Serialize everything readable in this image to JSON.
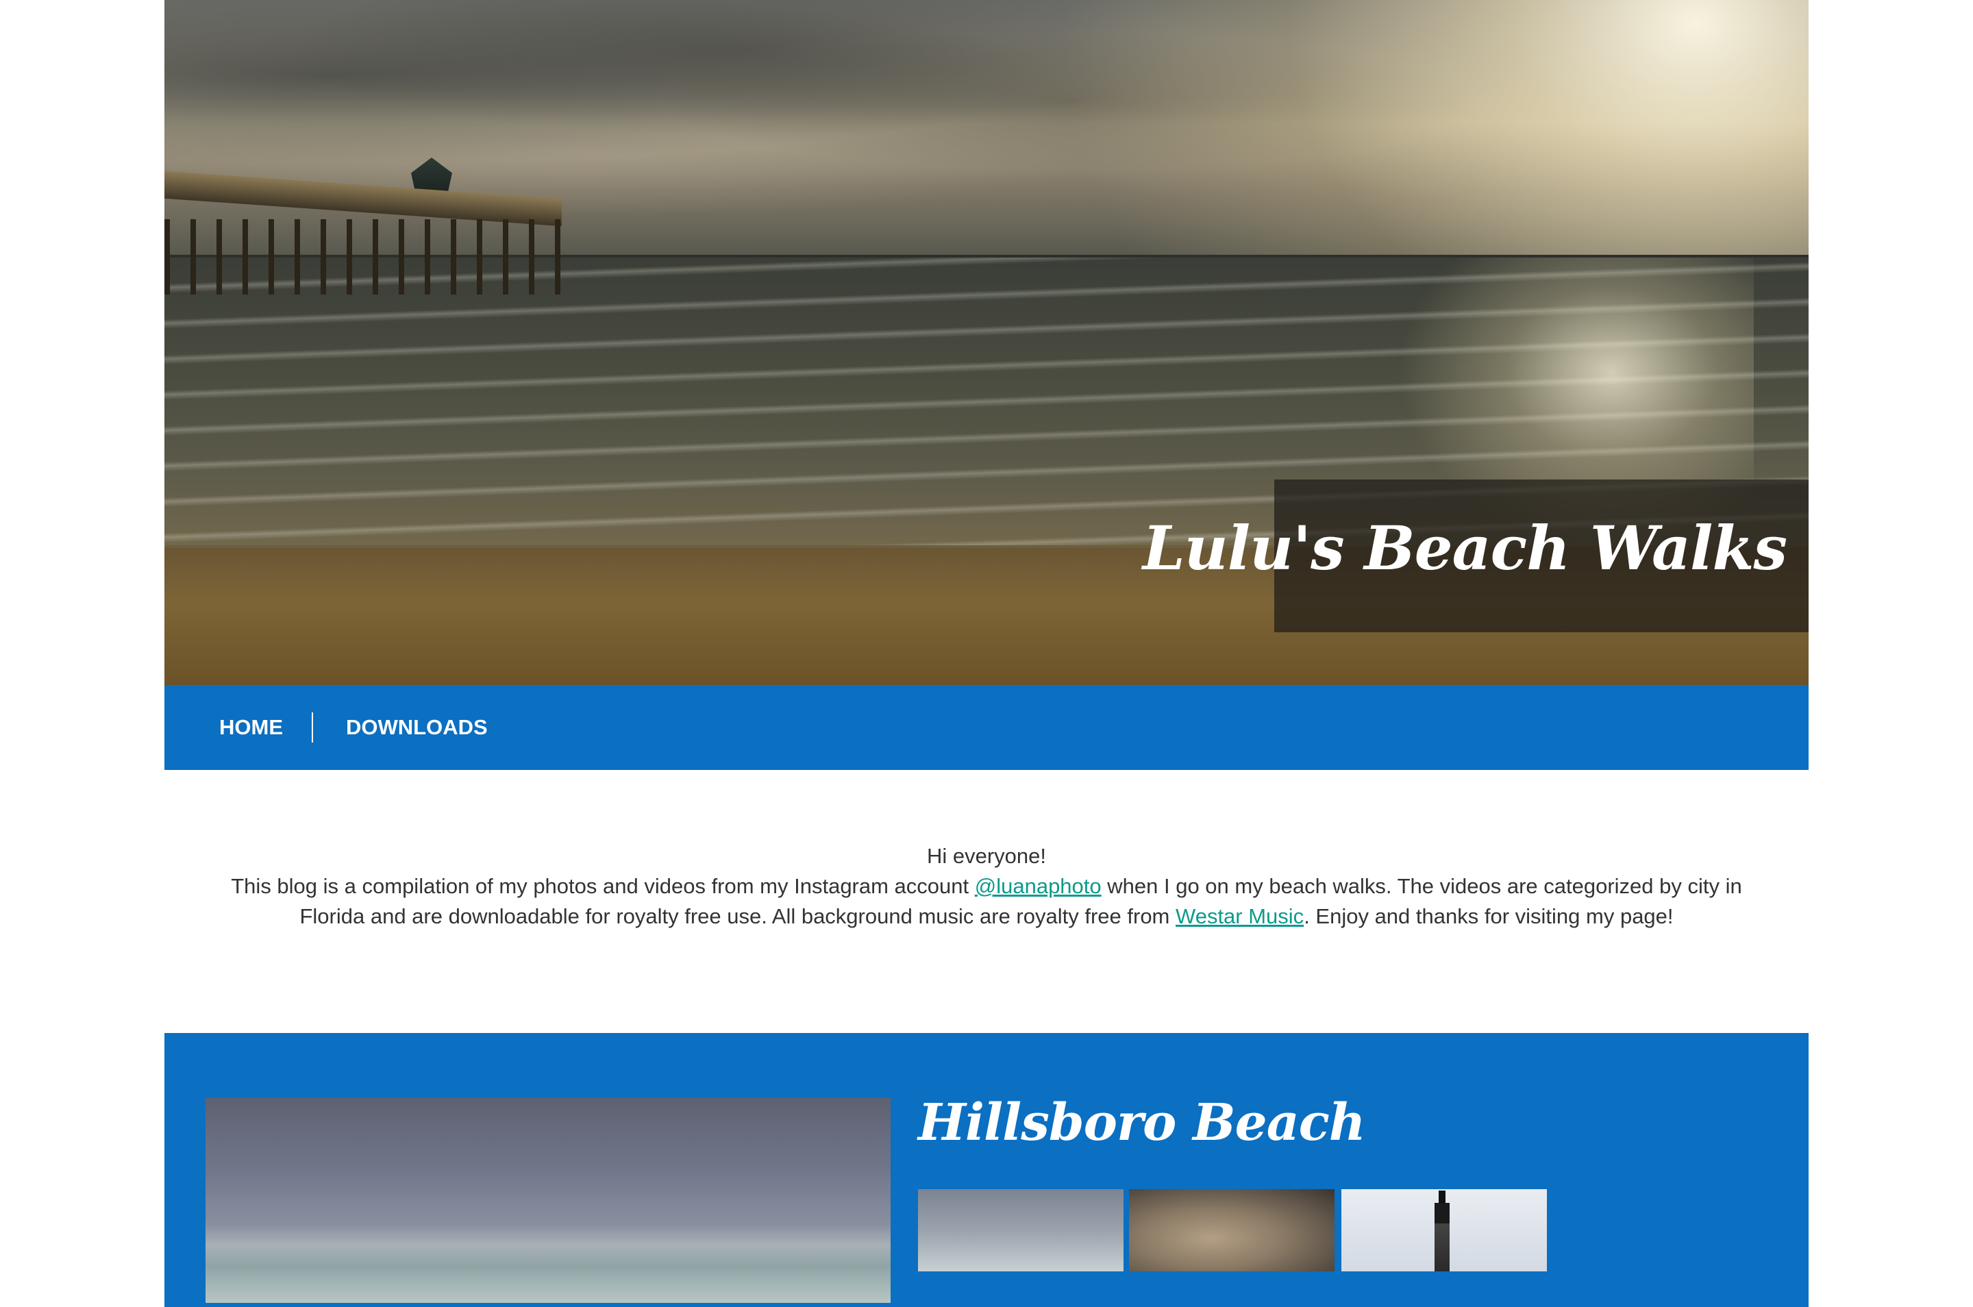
{
  "site": {
    "title": "Lulu's Beach Walks"
  },
  "nav": {
    "items": [
      {
        "label": "HOME"
      },
      {
        "label": "DOWNLOADS"
      }
    ]
  },
  "intro": {
    "greeting": "Hi everyone!",
    "text_1": "This blog is a compilation of my photos and videos from my Instagram account ",
    "link_instagram": "@luanaphoto",
    "text_2": " when I go on my beach walks. The videos are categorized by city in Florida and are downloadable for royalty free use. All background music are royalty free from ",
    "link_music": "Westar Music",
    "text_3": ". Enjoy and thanks for visiting my page!"
  },
  "post": {
    "title": "Hillsboro Beach"
  },
  "colors": {
    "nav_blue": "#0b6fc2",
    "link_teal": "#0d9a8c",
    "text_gray": "#333333"
  }
}
